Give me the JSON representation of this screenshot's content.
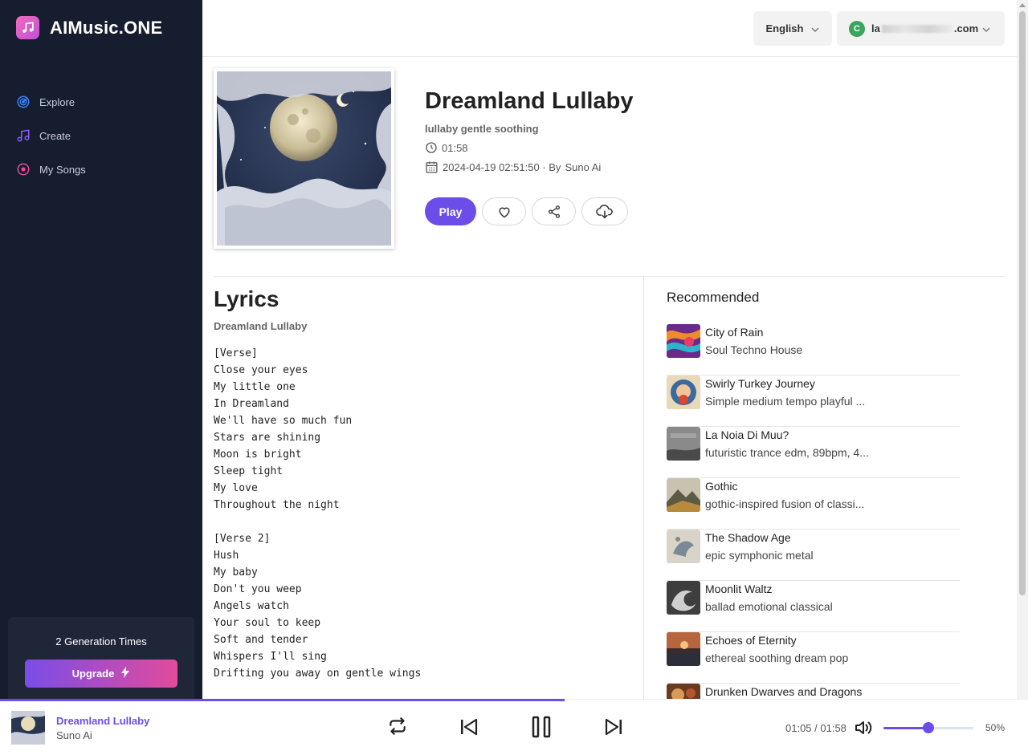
{
  "app": {
    "name": "AIMusic.ONE"
  },
  "nav": [
    {
      "label": "Explore",
      "icon": "target-icon",
      "color": "#3b82f6"
    },
    {
      "label": "Create",
      "icon": "music-note-icon",
      "color": "#8b5cf6"
    },
    {
      "label": "My Songs",
      "icon": "disc-icon",
      "color": "#ec4899"
    }
  ],
  "sidebar_card": {
    "text": "2 Generation Times",
    "upgrade_label": "Upgrade"
  },
  "header": {
    "language": "English",
    "user": {
      "avatar_letter": "C",
      "email_prefix": "la",
      "email_suffix": ".com"
    }
  },
  "song": {
    "title": "Dreamland Lullaby",
    "tags": "lullaby gentle soothing",
    "duration": "01:58",
    "created": "2024-04-19 02:51:50 · By",
    "author": "Suno Ai",
    "play_label": "Play"
  },
  "lyrics": {
    "heading": "Lyrics",
    "subtitle": "Dreamland Lullaby",
    "text": "[Verse]\nClose your eyes\nMy little one\nIn Dreamland\nWe'll have so much fun\nStars are shining\nMoon is bright\nSleep tight\nMy love\nThroughout the night\n\n[Verse 2]\nHush\nMy baby\nDon't you weep\nAngels watch\nYour soul to keep\nSoft and tender\nWhispers I'll sing\nDrifting you away on gentle wings"
  },
  "recommended": {
    "heading": "Recommended",
    "items": [
      {
        "title": "City of Rain",
        "desc": "Soul Techno House"
      },
      {
        "title": "Swirly Turkey Journey",
        "desc": "Simple medium tempo playful ..."
      },
      {
        "title": "La Noia Di Muu?",
        "desc": "futuristic trance edm, 89bpm, 4..."
      },
      {
        "title": "Gothic",
        "desc": "gothic-inspired fusion of classi..."
      },
      {
        "title": "The Shadow Age",
        "desc": "epic symphonic metal"
      },
      {
        "title": "Moonlit Waltz",
        "desc": "ballad emotional classical"
      },
      {
        "title": "Echoes of Eternity",
        "desc": "ethereal soothing dream pop"
      },
      {
        "title": "Drunken Dwarves and Dragons",
        "desc": ""
      }
    ]
  },
  "player": {
    "title": "Dreamland Lullaby",
    "artist": "Suno Ai",
    "time": "01:05 / 01:58",
    "progress_fraction": 0.549,
    "volume_label": "50%",
    "volume_fraction": 0.5
  },
  "colors": {
    "accent": "#6d4de8",
    "sidebar_bg": "#161d2f"
  }
}
